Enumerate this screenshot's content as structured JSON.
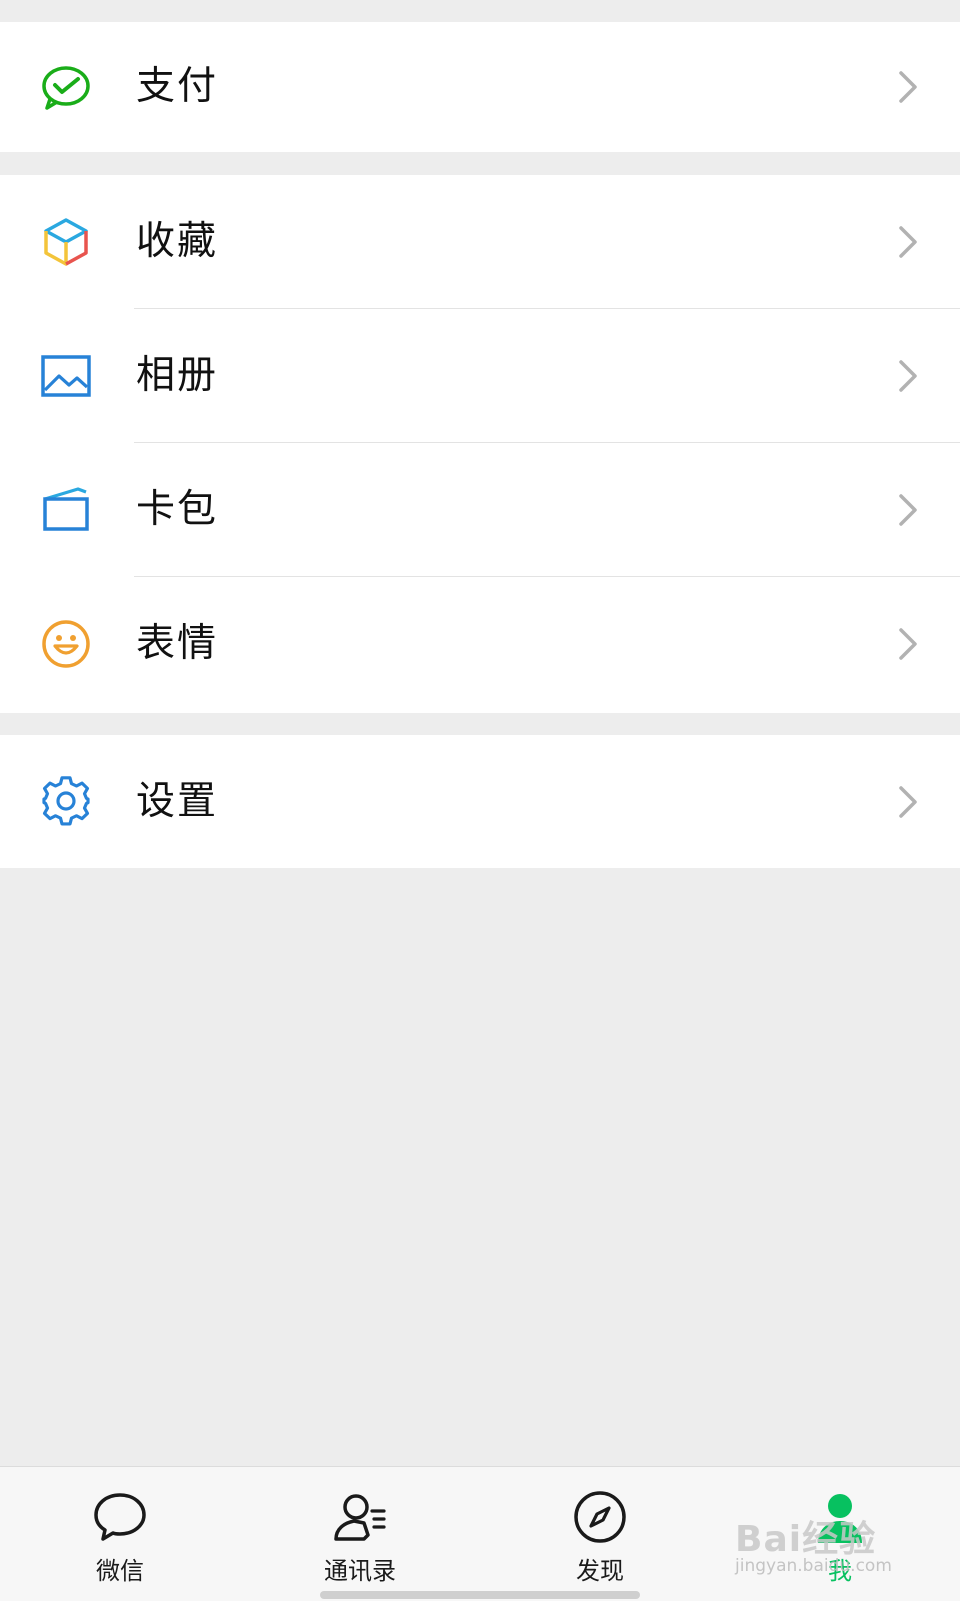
{
  "menu": {
    "pay": {
      "label": "支付",
      "icon": "wechat-pay-check-icon"
    },
    "favorites": {
      "label": "收藏",
      "icon": "cube-icon"
    },
    "album": {
      "label": "相册",
      "icon": "picture-icon"
    },
    "card_pack": {
      "label": "卡包",
      "icon": "card-wallet-icon"
    },
    "stickers": {
      "label": "表情",
      "icon": "smiley-icon"
    },
    "settings": {
      "label": "设置",
      "icon": "gear-icon"
    }
  },
  "tabbar": {
    "tabs": [
      {
        "label": "微信",
        "icon": "chat-bubble-icon",
        "active": false
      },
      {
        "label": "通讯录",
        "icon": "contacts-icon",
        "active": false
      },
      {
        "label": "发现",
        "icon": "compass-icon",
        "active": false
      },
      {
        "label": "我",
        "icon": "person-icon",
        "active": true
      }
    ]
  },
  "watermark": {
    "brand": "Bai经验",
    "url": "jingyan.baidu.com"
  },
  "colors": {
    "accent": "#07c160",
    "background": "#ededed",
    "card": "#ffffff",
    "pay_green": "#1aad19",
    "settings_blue": "#2782d7",
    "sticker_orange": "#f0a030"
  }
}
